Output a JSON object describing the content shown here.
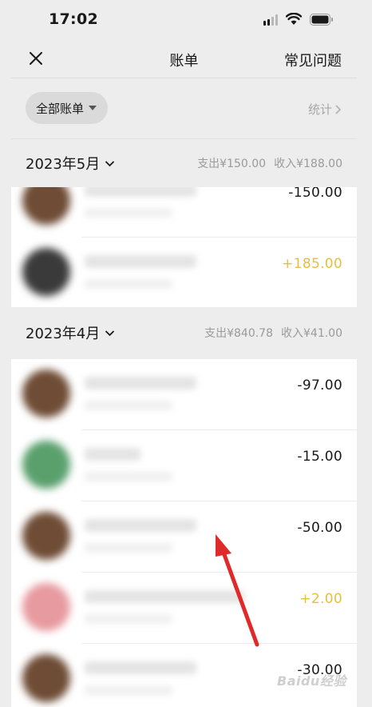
{
  "status": {
    "time": "17:02"
  },
  "nav": {
    "title": "账单",
    "faq_label": "常见问题"
  },
  "filter": {
    "label": "全部账单",
    "stats_label": "统计"
  },
  "months": [
    {
      "label": "2023年5月",
      "expense": "支出¥150.00",
      "income": "收入¥188.00",
      "transactions": [
        {
          "amount": "-150.00",
          "type": "expense",
          "avatar_color": "#6e4c35"
        },
        {
          "amount": "+185.00",
          "type": "income",
          "avatar_color": "#3a3a3a"
        }
      ]
    },
    {
      "label": "2023年4月",
      "expense": "支出¥840.78",
      "income": "收入¥41.00",
      "transactions": [
        {
          "amount": "-97.00",
          "type": "expense",
          "avatar_color": "#6e4c35"
        },
        {
          "amount": "-15.00",
          "type": "expense",
          "avatar_color": "#5aa06d"
        },
        {
          "amount": "-50.00",
          "type": "expense",
          "avatar_color": "#6e4c35"
        },
        {
          "amount": "+2.00",
          "type": "income",
          "avatar_color": "#e79aa0"
        },
        {
          "amount": "-30.00",
          "type": "expense",
          "avatar_color": "#6e4c35"
        }
      ]
    }
  ],
  "colors": {
    "income": "#e8bf3c",
    "annotation_arrow": "#e02a2a",
    "background": "#ededed"
  },
  "icons": [
    "signal-icon",
    "wifi-icon",
    "battery-icon",
    "close-icon",
    "caret-down-icon",
    "chevron-right-icon",
    "chevron-down-icon"
  ],
  "watermark": "Baidu经验"
}
